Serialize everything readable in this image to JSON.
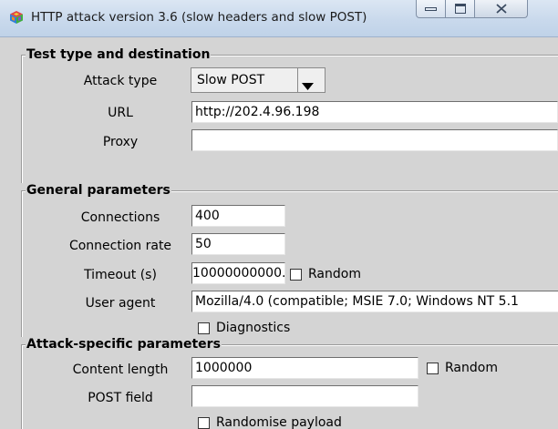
{
  "window": {
    "title": "HTTP attack version 3.6 (slow headers and slow POST)",
    "icon": "colorful-cube-icon"
  },
  "test_type": {
    "group_title": "Test type and destination",
    "attack_type_label": "Attack type",
    "attack_type_value": "Slow POST",
    "url_label": "URL",
    "url_value": "http://202.4.96.198",
    "proxy_label": "Proxy",
    "proxy_value": ""
  },
  "general": {
    "group_title": "General parameters",
    "connections_label": "Connections",
    "connections_value": "400",
    "connection_rate_label": "Connection rate",
    "connection_rate_value": "50",
    "timeout_label": "Timeout (s)",
    "timeout_value": "10000000000.",
    "timeout_random_label": "Random",
    "timeout_random_checked": false,
    "user_agent_label": "User agent",
    "user_agent_value": "Mozilla/4.0 (compatible; MSIE 7.0; Windows NT 5.1",
    "diagnostics_label": "Diagnostics",
    "diagnostics_checked": false
  },
  "attack_specific": {
    "group_title": "Attack-specific parameters",
    "content_length_label": "Content length",
    "content_length_value": "1000000",
    "content_length_random_label": "Random",
    "content_length_random_checked": false,
    "post_field_label": "POST field",
    "post_field_value": "",
    "randomise_payload_label": "Randomise payload",
    "randomise_payload_checked": false
  }
}
